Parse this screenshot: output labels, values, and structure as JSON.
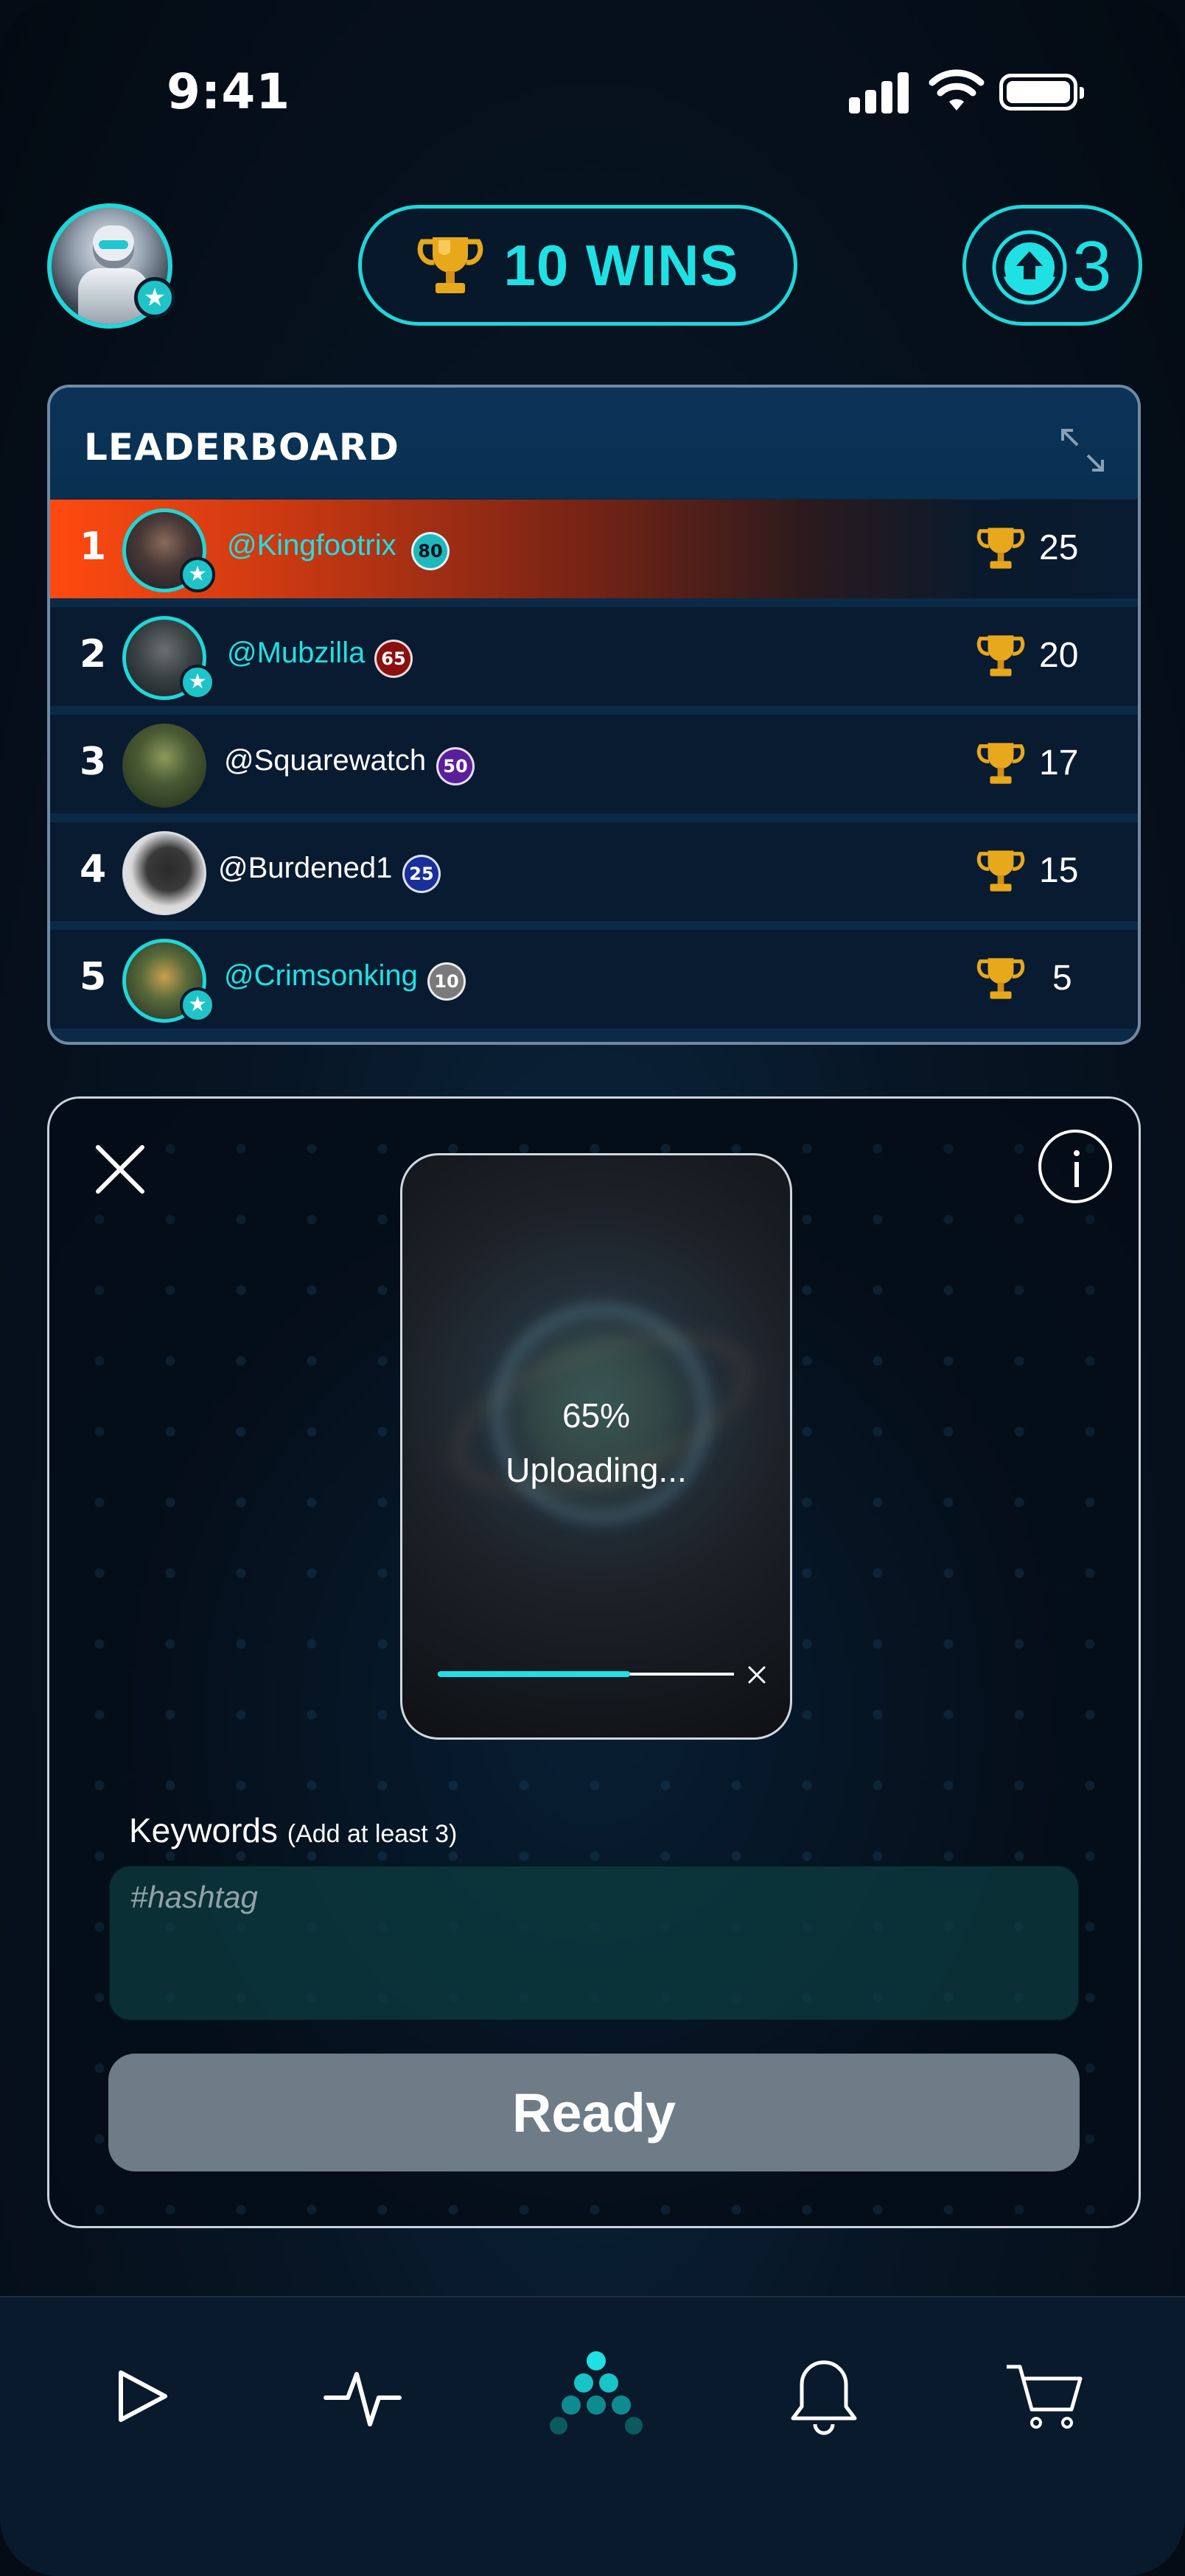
{
  "status_bar": {
    "time": "9:41"
  },
  "header": {
    "wins_label": "10 WINS",
    "uploads_count": "3"
  },
  "leaderboard": {
    "title": "LEADERBOARD",
    "rows": [
      {
        "rank": "1",
        "username": "@Kingfootrix",
        "level": "80",
        "level_color": "#1fb8bc",
        "score": "25"
      },
      {
        "rank": "2",
        "username": "@Mubzilla",
        "level": "65",
        "level_color": "#8a1010",
        "score": "20"
      },
      {
        "rank": "3",
        "username": "@Squarewatch",
        "level": "50",
        "level_color": "#5a1f9a",
        "score": "17"
      },
      {
        "rank": "4",
        "username": "@Burdened1",
        "level": "25",
        "level_color": "#1a2f9a",
        "score": "15"
      },
      {
        "rank": "5",
        "username": "@Crimsonking",
        "level": "10",
        "level_color": "#7a7a7a",
        "score": "5"
      }
    ]
  },
  "upload": {
    "progress_percent": 65,
    "progress_text": "65%",
    "status_text": "Uploading...",
    "keywords_label": "Keywords",
    "keywords_hint": "(Add at least 3)",
    "keywords_placeholder": "#hashtag",
    "ready_label": "Ready"
  },
  "nav": {
    "items": [
      "play-icon",
      "activity-icon",
      "home-logo-icon",
      "bell-icon",
      "cart-icon"
    ]
  },
  "colors": {
    "accent": "#1fe0e2",
    "first_place": "#ff4a10",
    "button_disabled": "#6d7c86"
  }
}
